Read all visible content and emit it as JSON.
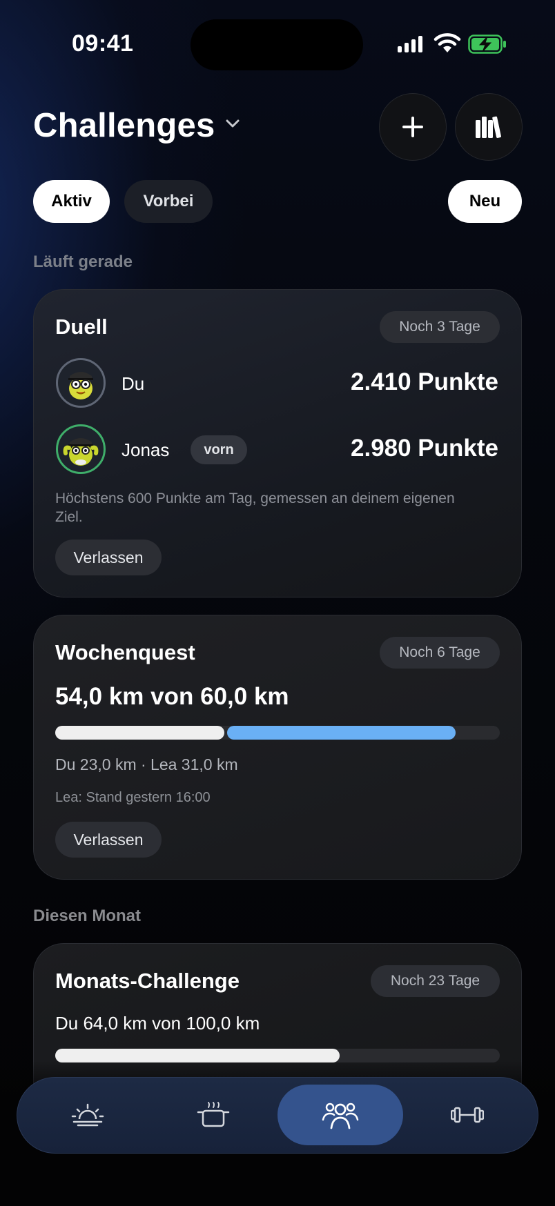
{
  "status_bar": {
    "time": "09:41"
  },
  "header": {
    "title": "Challenges"
  },
  "filters": {
    "active": "Aktiv",
    "past": "Vorbei",
    "new": "Neu"
  },
  "sections": {
    "running": "Läuft gerade",
    "this_month": "Diesen Monat"
  },
  "duel": {
    "title": "Duell",
    "badge": "Noch 3 Tage",
    "players": [
      {
        "name": "Du",
        "points": "2.410 Punkte"
      },
      {
        "name": "Jonas",
        "tag": "vorn",
        "points": "2.980 Punkte"
      }
    ],
    "description": "Höchstens 600 Punkte am Tag, gemessen an deinem eigenen Ziel.",
    "leave_label": "Verlassen"
  },
  "weekly_quest": {
    "title": "Wochenquest",
    "badge": "Noch 6 Tage",
    "progress_text": "54,0 km von 60,0 km",
    "progress": {
      "du_km": 23.0,
      "lea_km": 31.0,
      "goal_km": 60.0
    },
    "breakdown": "Du 23,0 km · Lea 31,0 km",
    "note": "Lea: Stand gestern 16:00",
    "leave_label": "Verlassen"
  },
  "monthly": {
    "title": "Monats-Challenge",
    "badge": "Noch 23 Tage",
    "progress_text": "Du 64,0 km von 100,0 km",
    "progress": {
      "du_km": 64.0,
      "goal_km": 100.0
    }
  },
  "colors": {
    "accent_blue": "#6ab0f5",
    "bar_white": "#efefef",
    "nav_active": "#34538d"
  },
  "nav": {
    "items": [
      {
        "icon": "sunrise-icon",
        "selected": false
      },
      {
        "icon": "cooking-pot-icon",
        "selected": false
      },
      {
        "icon": "people-group-icon",
        "selected": true
      },
      {
        "icon": "dumbbell-icon",
        "selected": false
      }
    ]
  }
}
